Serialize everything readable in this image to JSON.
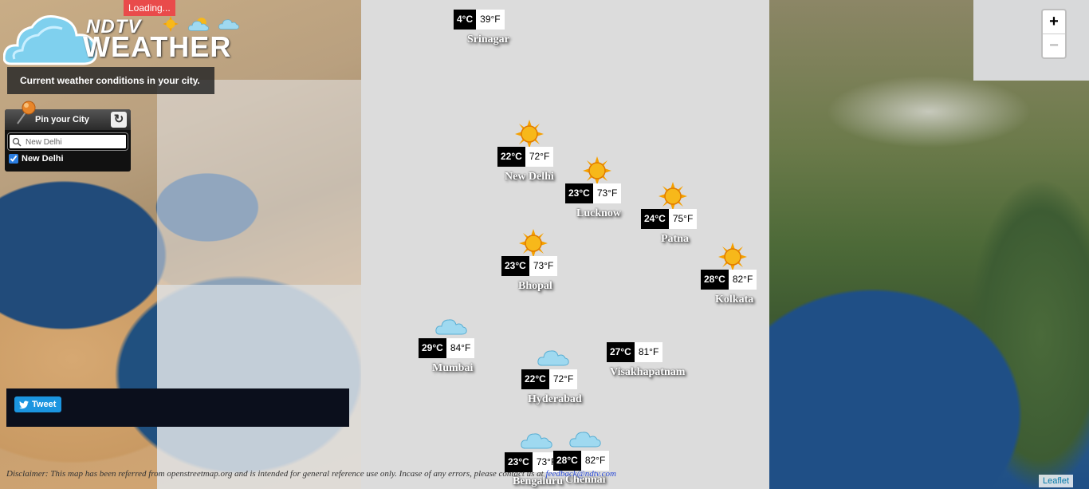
{
  "header": {
    "brand_top": "NDTV",
    "brand_main": "WEATHER",
    "loading": "Loading...",
    "tagline": "Current weather conditions in your city."
  },
  "pin_panel": {
    "title": "Pin your City",
    "search_value": "New Delhi",
    "checked_city": "New Delhi",
    "checked": true
  },
  "tweet": {
    "label": "Tweet"
  },
  "zoom": {
    "in": "+",
    "out": "−"
  },
  "disclaimer": {
    "text": "Disclaimer: This map has been referred from openstreetmap.org and is intended for general reference use only. Incase of any errors, please contact us at",
    "email": "feedback@ndtv.com"
  },
  "attribution": "Leaflet",
  "cities": [
    {
      "name": "Srinagar",
      "c": "4°C",
      "f": "39°F",
      "icon": "none"
    },
    {
      "name": "New Delhi",
      "c": "22°C",
      "f": "72°F",
      "icon": "sun"
    },
    {
      "name": "Lucknow",
      "c": "23°C",
      "f": "73°F",
      "icon": "sun"
    },
    {
      "name": "Patna",
      "c": "24°C",
      "f": "75°F",
      "icon": "sun"
    },
    {
      "name": "Bhopal",
      "c": "23°C",
      "f": "73°F",
      "icon": "sun"
    },
    {
      "name": "Kolkata",
      "c": "28°C",
      "f": "82°F",
      "icon": "sun"
    },
    {
      "name": "Mumbai",
      "c": "29°C",
      "f": "84°F",
      "icon": "cloud"
    },
    {
      "name": "Hyderabad",
      "c": "22°C",
      "f": "72°F",
      "icon": "cloud"
    },
    {
      "name": "Visakhapatnam",
      "c": "27°C",
      "f": "81°F",
      "icon": "none"
    },
    {
      "name": "Bengaluru",
      "c": "23°C",
      "f": "73°F",
      "icon": "cloud"
    },
    {
      "name": "Chennai",
      "c": "28°C",
      "f": "82°F",
      "icon": "cloud"
    }
  ]
}
